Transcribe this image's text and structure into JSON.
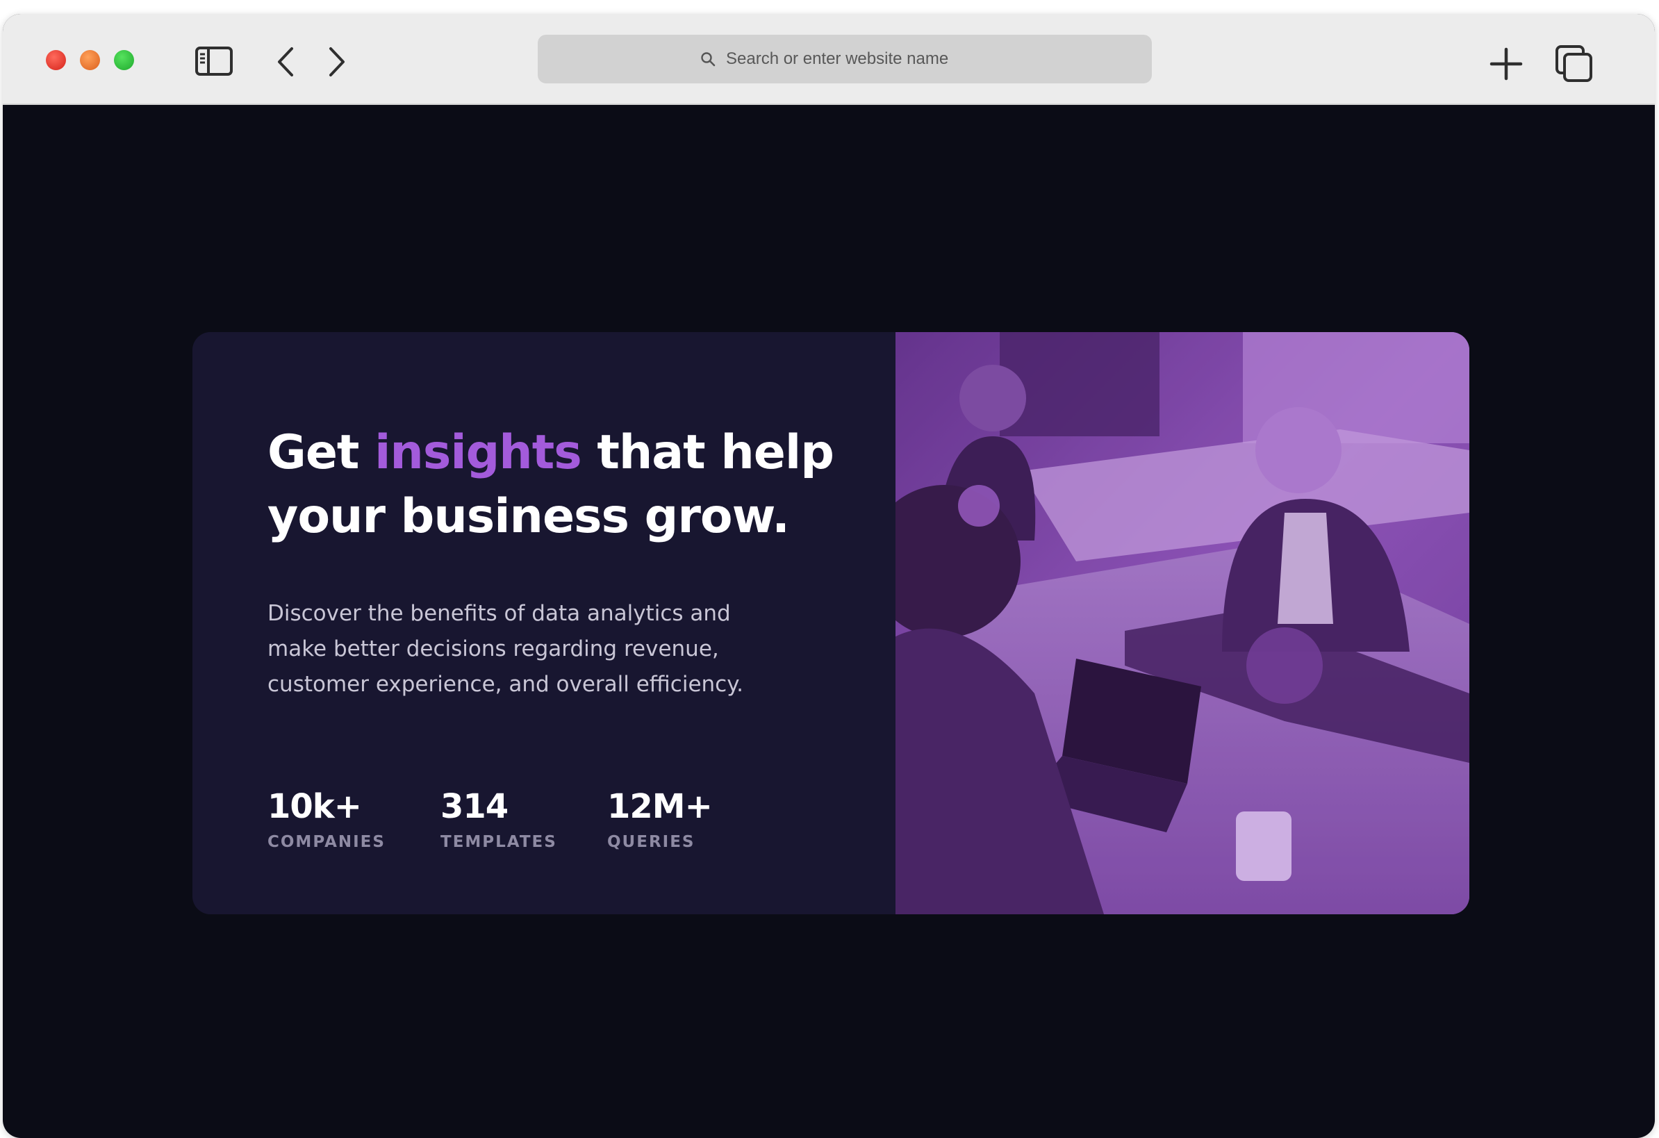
{
  "browser": {
    "address_bar": {
      "placeholder": "Search or enter website name"
    },
    "icons": {
      "sidebar": "sidebar-icon",
      "back": "chevron-left-icon",
      "forward": "chevron-right-icon",
      "search": "search-icon",
      "new_tab": "plus-icon",
      "tabs_overview": "tabs-icon"
    }
  },
  "hero": {
    "headline_before": "Get ",
    "headline_accent": "insights",
    "headline_after": " that help your business grow.",
    "description": "Discover the benefits of data analytics and make better decisions regarding revenue, customer experience, and overall efficiency.",
    "stats": [
      {
        "value": "10k+",
        "label": "COMPANIES"
      },
      {
        "value": "314",
        "label": "TEMPLATES"
      },
      {
        "value": "12M+",
        "label": "QUERIES"
      }
    ]
  },
  "colors": {
    "page_background": "#0b0c16",
    "card_background": "#181630",
    "accent": "#a35bdb",
    "photo_tint": "#8a4fb3",
    "stat_label": "#8e8aa3"
  }
}
